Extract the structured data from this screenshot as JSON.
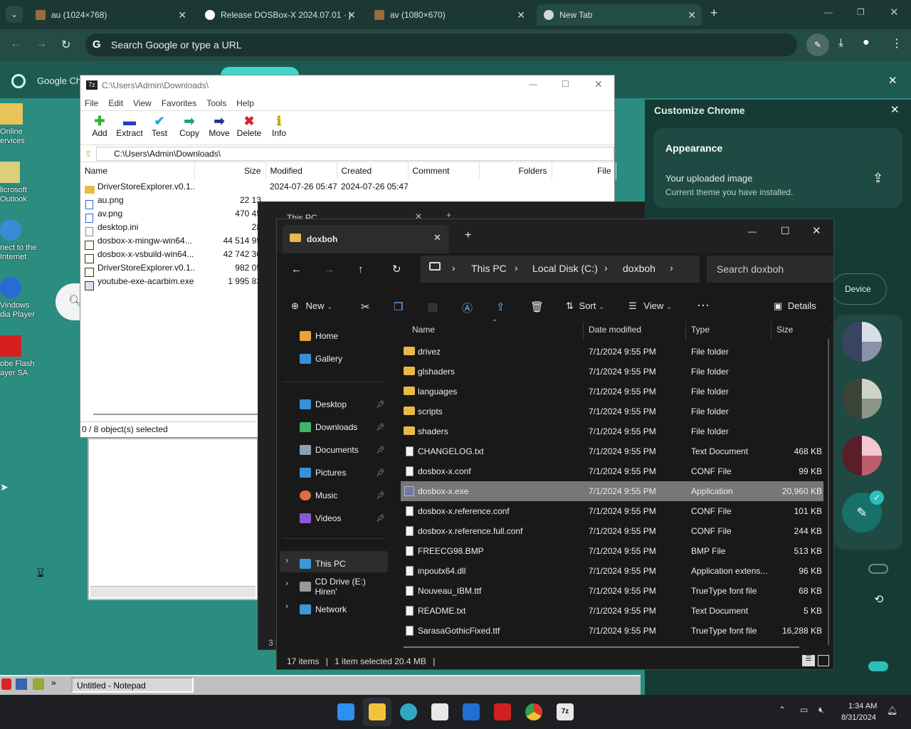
{
  "chrome": {
    "tabs": [
      {
        "label": "au (1024×768)"
      },
      {
        "label": "Release DOSBox-X 2024.07.01 · j"
      },
      {
        "label": "av (1080×670)"
      },
      {
        "label": "New Tab"
      }
    ],
    "omnibox_placeholder": "Search Google or type a URL",
    "ntp_label": "Google Ch"
  },
  "desktop": {
    "icons": [
      {
        "label": "Online\nervices"
      },
      {
        "label": "licrosoft\nOutlook"
      },
      {
        "label": "nect to the\nInternet"
      },
      {
        "label": "Vindows\ndia Player"
      },
      {
        "label": "obe Flash\nayer SA"
      }
    ]
  },
  "sevenzip": {
    "title": "C:\\Users\\Admin\\Downloads\\",
    "menu": [
      "File",
      "Edit",
      "View",
      "Favorites",
      "Tools",
      "Help"
    ],
    "tools": [
      {
        "label": "Add",
        "icon": "+",
        "color": "#2bb32b"
      },
      {
        "label": "Extract",
        "icon": "▬",
        "color": "#1f3fbf"
      },
      {
        "label": "Test",
        "icon": "✔",
        "color": "#22aacc"
      },
      {
        "label": "Copy",
        "icon": "➡",
        "color": "#1aa36a"
      },
      {
        "label": "Move",
        "icon": "➡",
        "color": "#1f2f8f"
      },
      {
        "label": "Delete",
        "icon": "✖",
        "color": "#dd2222"
      },
      {
        "label": "Info",
        "icon": "i",
        "color": "#c9a600"
      }
    ],
    "path": "C:\\Users\\Admin\\Downloads\\",
    "columns": [
      "Name",
      "Size",
      "Modified",
      "Created",
      "Comment",
      "Folders",
      "File"
    ],
    "rows": [
      {
        "name": "DriverStoreExplorer.v0.1...",
        "size": "",
        "modified": "2024-07-26 05:47",
        "created": "2024-07-26 05:47"
      },
      {
        "name": "au.png",
        "size": "22 13",
        "modified": "",
        "created": ""
      },
      {
        "name": "av.png",
        "size": "470 45",
        "modified": "",
        "created": ""
      },
      {
        "name": "desktop.ini",
        "size": "28",
        "modified": "",
        "created": ""
      },
      {
        "name": "dosbox-x-mingw-win64...",
        "size": "44 514 95",
        "modified": "",
        "created": ""
      },
      {
        "name": "dosbox-x-vsbuild-win64...",
        "size": "42 742 36",
        "modified": "",
        "created": ""
      },
      {
        "name": "DriverStoreExplorer.v0.1...",
        "size": "982 05",
        "modified": "",
        "created": ""
      },
      {
        "name": "youtube-exe-acarbim.exe",
        "size": "1 995 83",
        "modified": "",
        "created": ""
      }
    ],
    "status": "0 / 8 object(s) selected"
  },
  "win98": {
    "notepad_task": "Untitled - Notepad"
  },
  "explorer": {
    "tab_title": "doxboh",
    "behind_title": "This PC",
    "breadcrumb": [
      "This PC",
      "Local Disk (C:)",
      "doxboh"
    ],
    "search_placeholder": "Search doxboh",
    "commands": {
      "new": "New",
      "sort": "Sort",
      "view": "View",
      "details": "Details"
    },
    "nav": [
      {
        "label": "Home",
        "color": "#e8a23a"
      },
      {
        "label": "Gallery",
        "color": "#3b8fd9"
      },
      {
        "label": "Desktop",
        "color": "#3a8fd6",
        "pinned": true
      },
      {
        "label": "Downloads",
        "color": "#3fb56b",
        "pinned": true
      },
      {
        "label": "Documents",
        "color": "#8aa0b8",
        "pinned": true
      },
      {
        "label": "Pictures",
        "color": "#3a8fd6",
        "pinned": true
      },
      {
        "label": "Music",
        "color": "#e06a4a",
        "pinned": true
      },
      {
        "label": "Videos",
        "color": "#8a5ad6",
        "pinned": true
      },
      {
        "label": "This PC",
        "color": "#3a9ad6"
      },
      {
        "label": "CD Drive (E:) Hiren'",
        "color": "#9a9a9a"
      },
      {
        "label": "Network",
        "color": "#3a9ad6"
      }
    ],
    "columns": [
      "Name",
      "Date modified",
      "Type",
      "Size"
    ],
    "files": [
      {
        "name": "drivez",
        "date": "7/1/2024 9:55 PM",
        "type": "File folder",
        "size": "",
        "kind": "folder"
      },
      {
        "name": "glshaders",
        "date": "7/1/2024 9:55 PM",
        "type": "File folder",
        "size": "",
        "kind": "folder"
      },
      {
        "name": "languages",
        "date": "7/1/2024 9:55 PM",
        "type": "File folder",
        "size": "",
        "kind": "folder"
      },
      {
        "name": "scripts",
        "date": "7/1/2024 9:55 PM",
        "type": "File folder",
        "size": "",
        "kind": "folder"
      },
      {
        "name": "shaders",
        "date": "7/1/2024 9:55 PM",
        "type": "File folder",
        "size": "",
        "kind": "folder"
      },
      {
        "name": "CHANGELOG.txt",
        "date": "7/1/2024 9:55 PM",
        "type": "Text Document",
        "size": "468 KB",
        "kind": "doc"
      },
      {
        "name": "dosbox-x.conf",
        "date": "7/1/2024 9:55 PM",
        "type": "CONF File",
        "size": "99 KB",
        "kind": "doc"
      },
      {
        "name": "dosbox-x.exe",
        "date": "7/1/2024 9:55 PM",
        "type": "Application",
        "size": "20,960 KB",
        "kind": "exe",
        "selected": true
      },
      {
        "name": "dosbox-x.reference.conf",
        "date": "7/1/2024 9:55 PM",
        "type": "CONF File",
        "size": "101 KB",
        "kind": "doc"
      },
      {
        "name": "dosbox-x.reference.full.conf",
        "date": "7/1/2024 9:55 PM",
        "type": "CONF File",
        "size": "244 KB",
        "kind": "doc"
      },
      {
        "name": "FREECG98.BMP",
        "date": "7/1/2024 9:55 PM",
        "type": "BMP File",
        "size": "513 KB",
        "kind": "doc"
      },
      {
        "name": "inpoutx64.dll",
        "date": "7/1/2024 9:55 PM",
        "type": "Application extens...",
        "size": "96 KB",
        "kind": "doc"
      },
      {
        "name": "Nouveau_IBM.ttf",
        "date": "7/1/2024 9:55 PM",
        "type": "TrueType font file",
        "size": "68 KB",
        "kind": "doc"
      },
      {
        "name": "README.txt",
        "date": "7/1/2024 9:55 PM",
        "type": "Text Document",
        "size": "5 KB",
        "kind": "doc"
      },
      {
        "name": "SarasaGothicFixed.ttf",
        "date": "7/1/2024 9:55 PM",
        "type": "TrueType font file",
        "size": "16,288 KB",
        "kind": "doc"
      }
    ],
    "status": {
      "count": "17 items",
      "selected": "1 item selected  20.4 MB"
    },
    "behind_status": "3 i"
  },
  "customize": {
    "title": "Customize Chrome",
    "appearance": "Appearance",
    "uploaded": "Your uploaded image",
    "current": "Current theme you have installed.",
    "device": "Device"
  },
  "taskbar": {
    "time": "1:34 AM",
    "date": "8/31/2024"
  },
  "colors": {
    "ntp_bg": "#2b8c80",
    "chrome_dark": "#1c3833",
    "accent_teal": "#17a2a0"
  }
}
